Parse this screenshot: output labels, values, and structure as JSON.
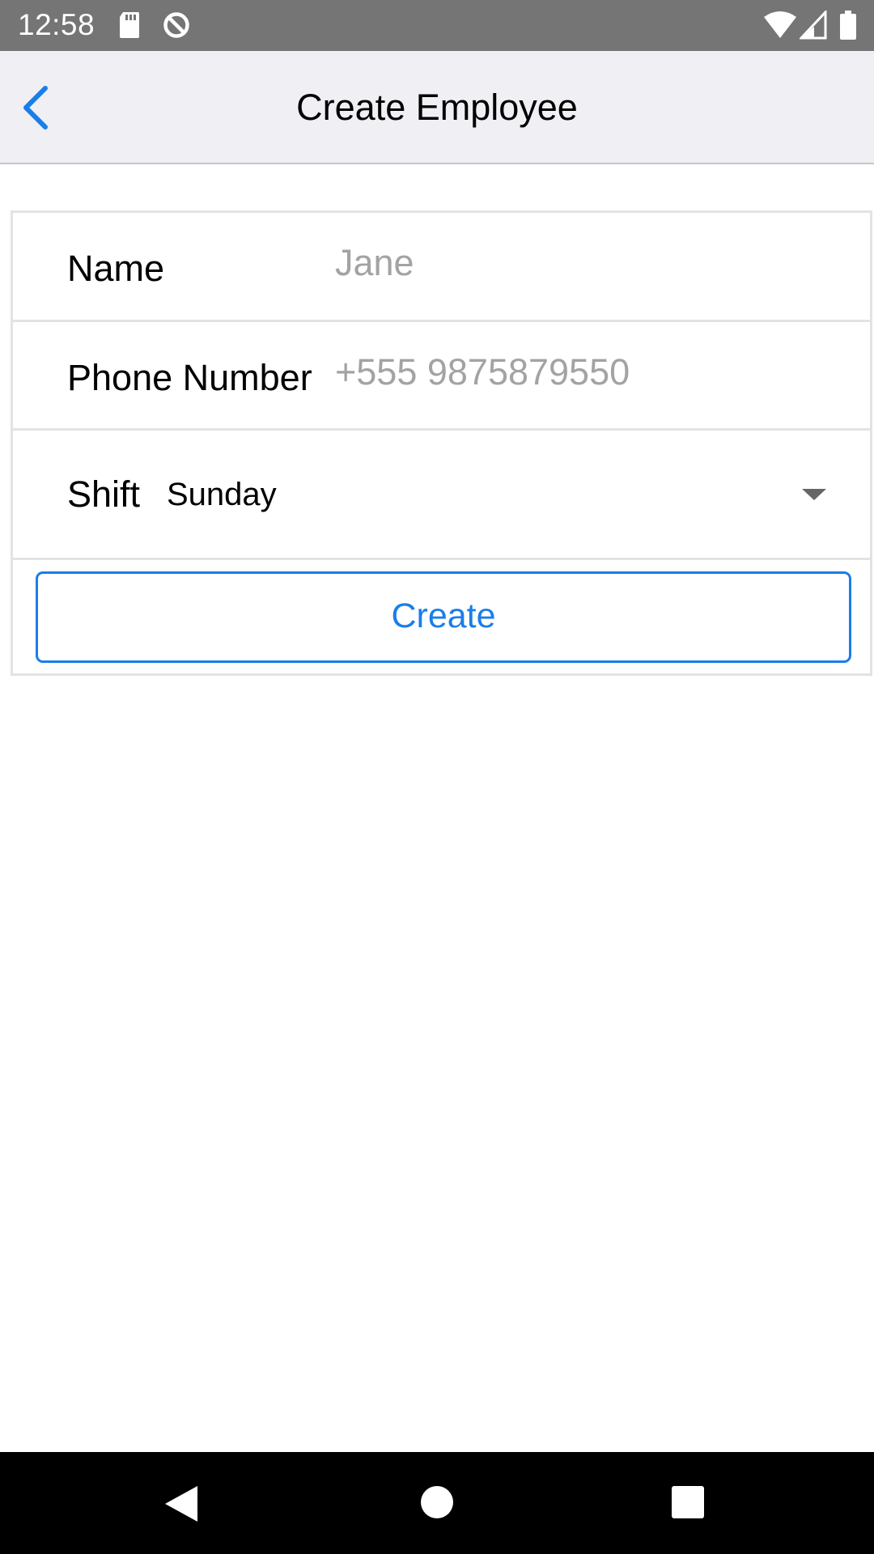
{
  "status_bar": {
    "time": "12:58",
    "icons": [
      "sd-card-icon",
      "data-saver-icon",
      "wifi-icon",
      "cellular-signal-icon",
      "battery-icon"
    ]
  },
  "nav": {
    "title": "Create Employee",
    "back_icon": "chevron-left-icon"
  },
  "form": {
    "name": {
      "label": "Name",
      "value": "",
      "placeholder": "Jane"
    },
    "phone": {
      "label": "Phone Number",
      "value": "",
      "placeholder": "+555 9875879550"
    },
    "shift": {
      "label": "Shift",
      "selected": "Sunday"
    },
    "create_label": "Create"
  },
  "android_nav": {
    "icons": [
      "back-triangle-icon",
      "home-circle-icon",
      "recents-square-icon"
    ]
  },
  "colors": {
    "accent": "#1a7ee8",
    "status_bar": "#757575",
    "nav_bar": "#efeff4",
    "placeholder": "#a3a3a3"
  }
}
